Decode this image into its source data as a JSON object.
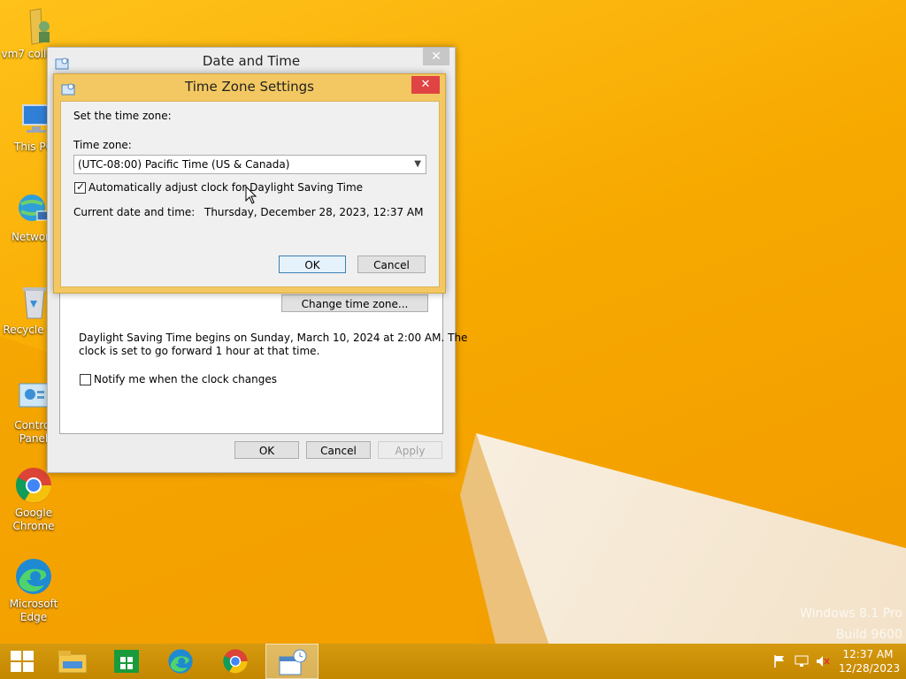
{
  "desktop": {
    "icons": [
      {
        "label": "vm7 collabv"
      },
      {
        "label": "This PC"
      },
      {
        "label": "Network"
      },
      {
        "label": "Recycle Bin"
      },
      {
        "label": "Control Panel"
      },
      {
        "label": "Google Chrome"
      },
      {
        "label": "Microsoft Edge"
      }
    ],
    "watermark_line1": "Windows 8.1 Pro",
    "watermark_line2": "Build 9600"
  },
  "date_time_window": {
    "title": "Date and Time",
    "close_label": "✕",
    "change_tz_label": "Change time zone...",
    "dst_text_line1": "Daylight Saving Time begins on Sunday, March 10, 2024 at 2:00 AM. The",
    "dst_text_line2": "clock is set to go forward 1 hour at that time.",
    "notify_label": "Notify me when the clock changes",
    "ok_label": "OK",
    "cancel_label": "Cancel",
    "apply_label": "Apply"
  },
  "tz_dialog": {
    "title": "Time Zone Settings",
    "close_label": "✕",
    "set_label": "Set the time zone:",
    "tz_label": "Time zone:",
    "tz_value": "(UTC-08:00) Pacific Time (US & Canada)",
    "dst_checkbox_label": "Automatically adjust clock for Daylight Saving Time",
    "dst_checked": true,
    "current_label": "Current date and time:",
    "current_value": "Thursday, December 28, 2023, 12:37 AM",
    "ok_label": "OK",
    "cancel_label": "Cancel"
  },
  "taskbar": {
    "time": "12:37 AM",
    "date": "12/28/2023"
  },
  "colors": {
    "desktop_accent": "#f6a800",
    "dialog_frame": "#f3c862",
    "close_red": "#e04343"
  }
}
